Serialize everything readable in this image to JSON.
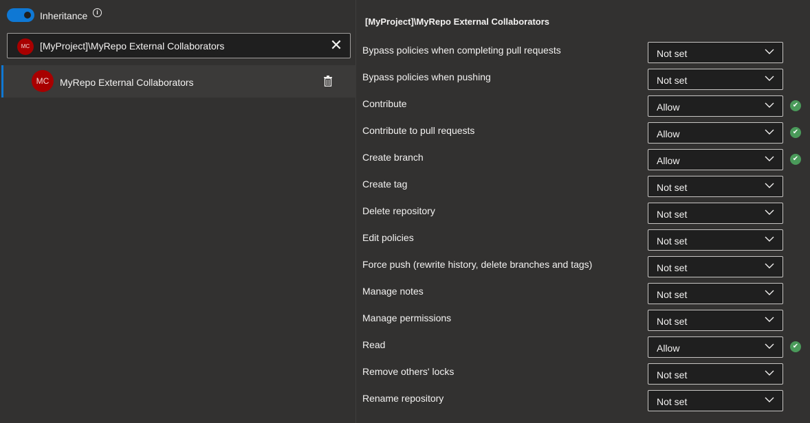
{
  "inheritance": {
    "label": "Inheritance",
    "enabled": true
  },
  "search": {
    "avatar": "MC",
    "value": "[MyProject]\\MyRepo External Collaborators"
  },
  "selected_item": {
    "avatar": "MC",
    "name": "MyRepo External Collaborators"
  },
  "panel": {
    "title": "[MyProject]\\MyRepo External Collaborators"
  },
  "colors": {
    "accent": "#0f78d4",
    "avatar": "#a80000",
    "allowed": "#4a9a5a"
  },
  "permissions": [
    {
      "label": "Bypass policies when completing pull requests",
      "value": "Not set"
    },
    {
      "label": "Bypass policies when pushing",
      "value": "Not set"
    },
    {
      "label": "Contribute",
      "value": "Allow",
      "check": true
    },
    {
      "label": "Contribute to pull requests",
      "value": "Allow",
      "check": true
    },
    {
      "label": "Create branch",
      "value": "Allow",
      "check": true
    },
    {
      "label": "Create tag",
      "value": "Not set"
    },
    {
      "label": "Delete repository",
      "value": "Not set"
    },
    {
      "label": "Edit policies",
      "value": "Not set"
    },
    {
      "label": "Force push (rewrite history, delete branches and tags)",
      "value": "Not set"
    },
    {
      "label": "Manage notes",
      "value": "Not set"
    },
    {
      "label": "Manage permissions",
      "value": "Not set"
    },
    {
      "label": "Read",
      "value": "Allow",
      "check": true
    },
    {
      "label": "Remove others' locks",
      "value": "Not set"
    },
    {
      "label": "Rename repository",
      "value": "Not set"
    }
  ]
}
